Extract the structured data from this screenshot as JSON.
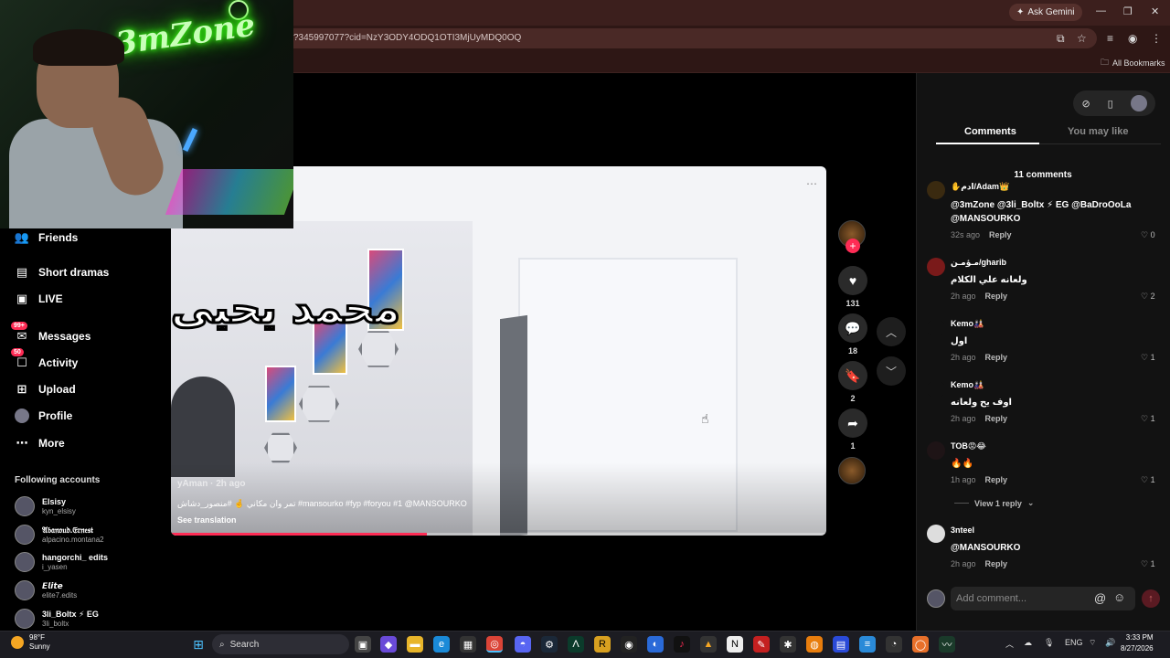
{
  "browser": {
    "ask_gemini": "Ask Gemini",
    "url": "?345997077?cid=NzY3ODY4ODQ1OTI3MjUyMDQ0OQ",
    "all_bookmarks": "All Bookmarks"
  },
  "webcam": {
    "sign": "3mZone"
  },
  "sidebar": {
    "items": [
      {
        "label": "Friends",
        "icon": "friends-icon"
      },
      {
        "label": "Short dramas",
        "icon": "film-icon"
      },
      {
        "label": "LIVE",
        "icon": "live-icon"
      },
      {
        "label": "Messages",
        "icon": "messages-icon",
        "badge": "99+"
      },
      {
        "label": "Activity",
        "icon": "activity-icon",
        "badge": "50"
      },
      {
        "label": "Upload",
        "icon": "upload-icon"
      },
      {
        "label": "Profile",
        "icon": "profile-avatar"
      },
      {
        "label": "More",
        "icon": "more-icon"
      }
    ],
    "following_title": "Following accounts",
    "following": [
      {
        "name": "Elsisy",
        "handle": "kyn_elsisy"
      },
      {
        "name": "𝔄𝔟𝔞𝔫𝔬𝔲𝔡.𝔈𝔯𝔫𝔢𝔰𝔱",
        "handle": "alpacino.montana2"
      },
      {
        "name": "hangorchi_ edits",
        "handle": "i_yasen"
      },
      {
        "name": "𝙀𝙡𝙞𝙩𝙚",
        "handle": "elite7.edits"
      },
      {
        "name": "3li_Boltx ⚡ EG",
        "handle": "3li_boltx"
      }
    ]
  },
  "video": {
    "overlay_text": "محمد يحيى",
    "author": "yAman · 2h ago",
    "caption": "تمر وان مكاني 🤞 #منصور_دشاش #mansourko #fyp #foryou #1 @MANSOURKO",
    "see_translation": "See translation",
    "progress": 0.39,
    "likes": "131",
    "comments": "18",
    "saves": "2",
    "shares": "1"
  },
  "comments_panel": {
    "tab_comments": "Comments",
    "tab_you_may_like": "You may like",
    "count_label": "11 comments",
    "reply_label": "Reply",
    "comments": [
      {
        "user": "✋ادم/Adam👑",
        "text": "@3mZone @3li_Boltx ⚡ EG @BaDroOoLa",
        "text2": "@MANSOURKO",
        "time": "32s ago",
        "likes": "0"
      },
      {
        "user": "مـؤمـن/gharib",
        "text": "ولعانه علي الكلام",
        "text2": "",
        "time": "2h ago",
        "likes": "2"
      },
      {
        "user": "Kemo🎎",
        "text": "اول",
        "text2": "",
        "time": "2h ago",
        "likes": "1"
      },
      {
        "user": "Kemo🎎",
        "text": "اوف يح ولعانه",
        "text2": "",
        "time": "2h ago",
        "likes": "1"
      },
      {
        "user": "TOB😡😂",
        "text": "🔥🔥",
        "text2": "",
        "time": "1h ago",
        "likes": "1"
      },
      {
        "user": "3nteel",
        "text": "@MANSOURKO",
        "text2": "",
        "time": "2h ago",
        "likes": "1"
      }
    ],
    "view_reply": "View 1 reply",
    "add_comment_placeholder": "Add comment..."
  },
  "taskbar": {
    "temp": "98°F",
    "condition": "Sunny",
    "search": "Search",
    "lang": "ENG",
    "time": "3:33 PM",
    "date": "8/27/2026"
  },
  "colors": {
    "accent": "#fe2c55",
    "chrome": "#3c1f1d",
    "panel": "#121212"
  }
}
